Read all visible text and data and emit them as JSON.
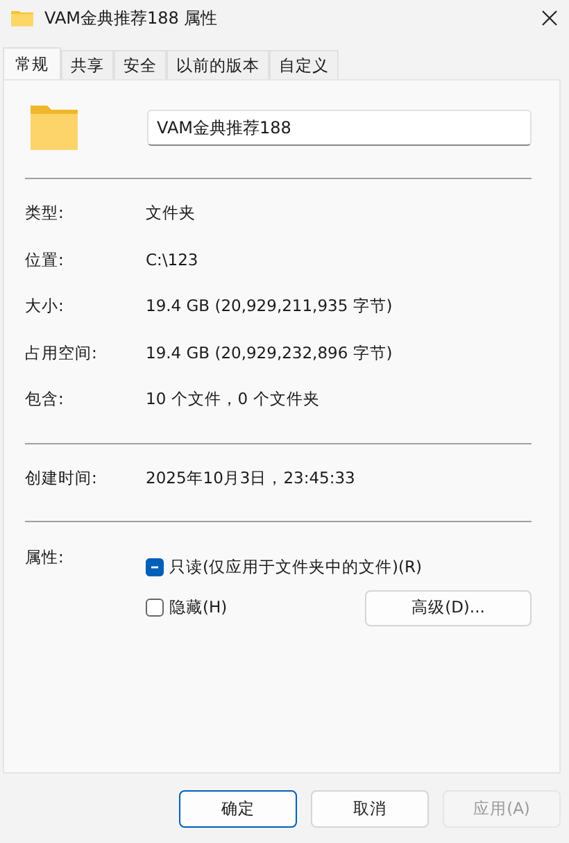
{
  "window": {
    "title": "VAM金典推荐188 属性"
  },
  "tabs": [
    {
      "label": "常规",
      "selected": true
    },
    {
      "label": "共享",
      "selected": false
    },
    {
      "label": "安全",
      "selected": false
    },
    {
      "label": "以前的版本",
      "selected": false
    },
    {
      "label": "自定义",
      "selected": false
    }
  ],
  "name_field": {
    "value": "VAM金典推荐188"
  },
  "groups": [
    [
      {
        "label": "类型:",
        "value": "文件夹"
      },
      {
        "label": "位置:",
        "value": "C:\\123"
      },
      {
        "label": "大小:",
        "value": "19.4 GB (20,929,211,935 字节)"
      },
      {
        "label": "占用空间:",
        "value": "19.4 GB (20,929,232,896 字节)"
      },
      {
        "label": "包含:",
        "value": "10 个文件，0 个文件夹"
      }
    ],
    [
      {
        "label": "创建时间:",
        "value": "2025年10月3日，23:45:33"
      }
    ]
  ],
  "attributes": {
    "label": "属性:",
    "options": [
      {
        "label": "只读(仅应用于文件夹中的文件)(R)",
        "indeterminate": true
      },
      {
        "label": "隐藏(H)",
        "checked": false,
        "indeterminate": false
      }
    ],
    "advanced_button": "高级(D)..."
  },
  "buttons": [
    {
      "label": "确定",
      "default": true,
      "disabled": false
    },
    {
      "label": "取消",
      "default": false,
      "disabled": false
    },
    {
      "label": "应用(A)",
      "default": false,
      "disabled": true
    }
  ]
}
